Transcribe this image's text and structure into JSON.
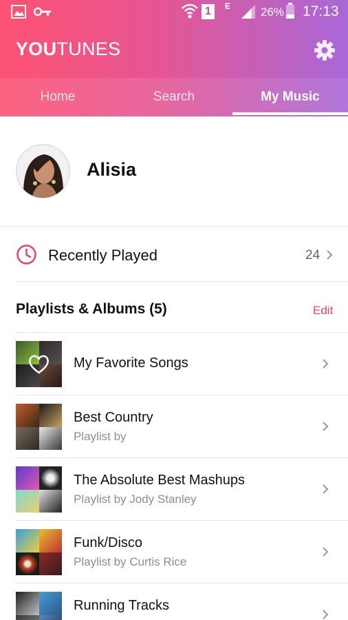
{
  "status_bar": {
    "battery": "26%",
    "time": "17:13",
    "sim_slot": "1",
    "network_type": "E",
    "icons": [
      "gallery-icon",
      "key-icon",
      "wifi-icon",
      "sim-icon",
      "signal-icon",
      "battery-icon"
    ]
  },
  "header": {
    "title_bold": "YOU",
    "title_light": "TUNES",
    "settings_icon": "gear-icon"
  },
  "tabs": [
    {
      "label": "Home",
      "active": false
    },
    {
      "label": "Search",
      "active": false
    },
    {
      "label": "My Music",
      "active": true
    }
  ],
  "profile": {
    "name": "Alisia"
  },
  "recently_played": {
    "label": "Recently Played",
    "count": "24",
    "icon": "clock-icon"
  },
  "playlists": {
    "title": "Playlists & Albums (5)",
    "edit_label": "Edit",
    "items": [
      {
        "title": "My Favorite Songs",
        "subtitle": ""
      },
      {
        "title": "Best Country",
        "subtitle": "Playlist by"
      },
      {
        "title": "The Absolute Best Mashups",
        "subtitle": "Playlist by Jody Stanley"
      },
      {
        "title": "Funk/Disco",
        "subtitle": "Playlist by Curtis Rice"
      },
      {
        "title": "Running Tracks",
        "subtitle": ""
      }
    ]
  },
  "colors": {
    "accent": "#f0406a",
    "gradient_start": "#fd5272",
    "gradient_end": "#a868d8"
  }
}
